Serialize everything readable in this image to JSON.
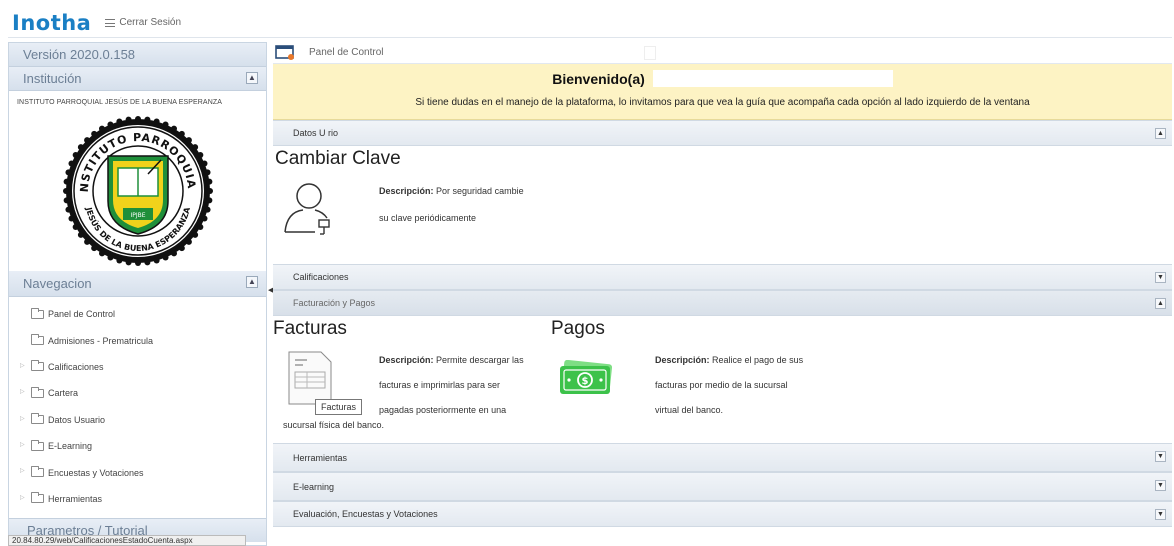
{
  "topbar": {
    "logo": "Inotha",
    "logout_label": "Cerrar Sesión"
  },
  "sidebar": {
    "version": "Versión 2020.0.158",
    "institution_header": "Institución",
    "institution_name": "INSTITUTO PARROQUIAL JESÚS DE LA BUENA ESPERANZA",
    "seal": {
      "top_text": "INSTITUTO PARROQUIAL",
      "bottom_text": "JESÚS DE LA BUENA ESPERANZA",
      "band_text": "IPJBE"
    },
    "nav_header": "Navegacion",
    "nav_items": [
      {
        "label": "Panel de Control",
        "expandable": false
      },
      {
        "label": "Admisiones - Prematricula",
        "expandable": false
      },
      {
        "label": "Calificaciones",
        "expandable": true
      },
      {
        "label": "Cartera",
        "expandable": true
      },
      {
        "label": "Datos Usuario",
        "expandable": true
      },
      {
        "label": "E-Learning",
        "expandable": true
      },
      {
        "label": "Encuestas y Votaciones",
        "expandable": true
      },
      {
        "label": "Herramientas",
        "expandable": true
      }
    ],
    "params_header": "Parametros / Tutorial"
  },
  "status_bar": "20.84.80.29/web/CalificacionesEstadoCuenta.aspx",
  "main": {
    "breadcrumb": "Panel de Control",
    "welcome_title": "Bienvenido(a)",
    "welcome_subtitle": "Si tiene dudas en el manejo de la plataforma, lo invitamos para que vea la guía que acompaña cada opción al lado izquierdo de la ventana",
    "sections": {
      "datos_usuario": {
        "label": "Datos U    rio",
        "state": "expanded"
      },
      "calificaciones": {
        "label": "Calificaciones",
        "state": "collapsed"
      },
      "facturacion": {
        "label": "Facturación y Pagos",
        "state": "expanded"
      },
      "herramientas": {
        "label": "Herramientas",
        "state": "collapsed"
      },
      "elearning": {
        "label": "E-learning",
        "state": "collapsed"
      },
      "evaluacion": {
        "label": "Evaluación, Encuestas y Votaciones",
        "state": "collapsed"
      }
    },
    "cambiar_clave": {
      "title": "Cambiar Clave",
      "desc_label": "Descripción:",
      "desc_line1": "Por seguridad cambie",
      "desc_line2": "su clave periódicamente"
    },
    "facturas": {
      "title": "Facturas",
      "desc_label": "Descripción:",
      "desc_line1": "Permite descargar las",
      "desc_line2": "facturas e imprimirlas para ser",
      "desc_line3": "pagadas posteriormente en una",
      "desc_line4": "sucursal física del banco.",
      "tooltip": "Facturas"
    },
    "pagos": {
      "title": "Pagos",
      "desc_label": "Descripción:",
      "desc_line1": "Realice el pago de sus",
      "desc_line2": "facturas por medio de la sucursal",
      "desc_line3": "virtual del banco."
    },
    "toggle_expanded": "▲",
    "toggle_collapsed": "▼"
  },
  "colors": {
    "brand": "#1a7fc4",
    "welcome_bg": "#fdf3c4",
    "money_green": "#3cc24a",
    "seal_green": "#1f8f3a",
    "seal_yellow": "#f1d21b"
  }
}
